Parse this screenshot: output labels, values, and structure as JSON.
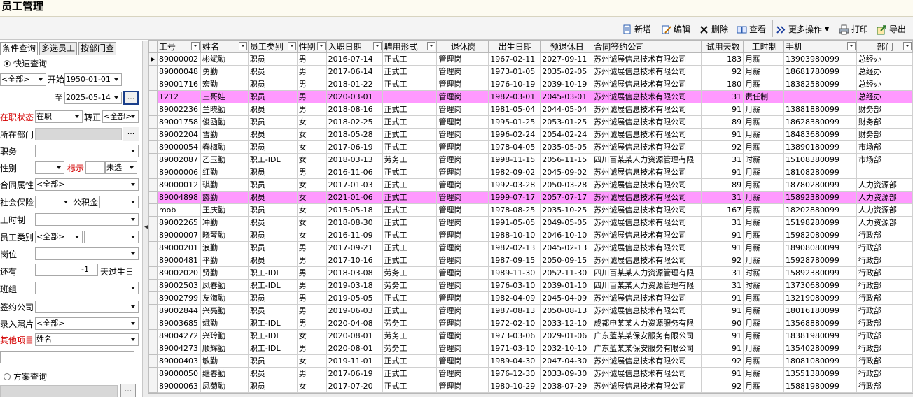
{
  "window_title": "员工管理",
  "toolbar": [
    {
      "label": "新增",
      "icon": "new-doc-icon"
    },
    {
      "label": "编辑",
      "icon": "edit-icon"
    },
    {
      "label": "删除",
      "icon": "delete-x-icon"
    },
    {
      "label": "查看",
      "icon": "view-book-icon"
    },
    {
      "label": "更多操作",
      "icon": "double-chevron-icon"
    },
    {
      "label": "打印",
      "icon": "printer-icon"
    },
    {
      "label": "导出",
      "icon": "export-icon"
    }
  ],
  "tabs": [
    "条件查询",
    "多选员工",
    "按部门查"
  ],
  "filters": {
    "quick_query": "快速查询",
    "scope": "<全部>",
    "start_label": "开始",
    "start_date": "1950-01-01",
    "to_label": "至",
    "end_date": "2025-05-14",
    "ellipsis": "...",
    "status_label": "在职状态",
    "status_value": "在职",
    "regular_label": "转正",
    "regular_value": "<全部>",
    "dept_label": "所在部门",
    "post_label": "职务",
    "gender_label": "性别",
    "show_label": "标示",
    "unselected": "未选",
    "contract_label": "合同属性",
    "contract_value": "<全部>",
    "insurance_label": "社会保险",
    "fund_label": "公积金",
    "worktime_label": "工时制",
    "emptype_label": "员工类别",
    "emptype_value": "<全部>",
    "position_label": "岗位",
    "birthday_prefix": "还有",
    "birthday_value": "-1",
    "birthday_suffix": "天过生日",
    "team_label": "班组",
    "company_label": "签约公司",
    "photo_label": "录入照片",
    "photo_value": "<全部>",
    "other_label": "其他项目",
    "other_value": "姓名",
    "plan_query": "方案查询"
  },
  "columns": [
    "工号",
    "姓名",
    "员工类别",
    "性别",
    "入职日期",
    "聘用形式",
    "退休岗",
    "出生日期",
    "预退休日",
    "合同签约公司",
    "试用天数",
    "工时制",
    "手机",
    "部门"
  ],
  "rows": [
    [
      "89000002",
      "彬斌勤",
      "职员",
      "男",
      "2016-07-14",
      "正式工",
      "管理岗",
      "1967-02-11",
      "2027-09-11",
      "苏州诚展信息技术有限公司",
      "183",
      "月薪",
      "13903980099",
      "总经办"
    ],
    [
      "89000048",
      "勇勤",
      "职员",
      "男",
      "2017-06-14",
      "正式工",
      "管理岗",
      "1973-01-05",
      "2035-02-05",
      "苏州诚展信息技术有限公司",
      "92",
      "月薪",
      "18681780099",
      "总经办"
    ],
    [
      "89001716",
      "宏勤",
      "职员",
      "男",
      "2018-01-22",
      "正式工",
      "管理岗",
      "1976-10-19",
      "2039-10-19",
      "苏州诚展信息技术有限公司",
      "180",
      "月薪",
      "18382580099",
      "总经办"
    ],
    [
      "1212",
      "三哥娃",
      "职员",
      "男",
      "2020-03-01",
      "",
      "管理岗",
      "1982-03-01",
      "2045-03-01",
      "苏州诚展信息技术有限公司",
      "31",
      "责任制",
      "",
      "总经办"
    ],
    [
      "89002236",
      "兰晓勤",
      "职员",
      "男",
      "2018-08-16",
      "正式工",
      "管理岗",
      "1981-05-04",
      "2044-05-04",
      "苏州诚展信息技术有限公司",
      "91",
      "月薪",
      "13881880099",
      "财务部"
    ],
    [
      "89001758",
      "俊函勤",
      "职员",
      "女",
      "2018-02-25",
      "正式工",
      "管理岗",
      "1995-01-25",
      "2053-01-25",
      "苏州诚展信息技术有限公司",
      "89",
      "月薪",
      "18628380099",
      "财务部"
    ],
    [
      "89002204",
      "雪勤",
      "职员",
      "女",
      "2018-05-28",
      "正式工",
      "管理岗",
      "1996-02-24",
      "2054-02-24",
      "苏州诚展信息技术有限公司",
      "91",
      "月薪",
      "18483680099",
      "财务部"
    ],
    [
      "89000054",
      "春梅勤",
      "职员",
      "女",
      "2017-06-19",
      "正式工",
      "管理岗",
      "1978-04-05",
      "2035-05-05",
      "苏州诚展信息技术有限公司",
      "92",
      "月薪",
      "13890180099",
      "市场部"
    ],
    [
      "89002087",
      "乙玉勤",
      "职工-IDL",
      "女",
      "2018-03-13",
      "劳务工",
      "管理岗",
      "1998-11-15",
      "2056-11-15",
      "四川百某某人力资源管理有限",
      "31",
      "时薪",
      "15108380099",
      "市场部"
    ],
    [
      "89000006",
      "红勤",
      "职员",
      "男",
      "2016-11-06",
      "正式工",
      "管理岗",
      "1982-09-02",
      "2045-09-02",
      "苏州诚展信息技术有限公司",
      "91",
      "月薪",
      "18108280099",
      ""
    ],
    [
      "89000012",
      "琪勤",
      "职员",
      "女",
      "2017-01-03",
      "正式工",
      "管理岗",
      "1992-03-28",
      "2050-03-28",
      "苏州诚展信息技术有限公司",
      "89",
      "月薪",
      "18780280099",
      "人力资源部"
    ],
    [
      "89004898",
      "露勤",
      "职员",
      "女",
      "2021-01-06",
      "正式工",
      "管理岗",
      "1999-07-17",
      "2057-07-17",
      "苏州诚展信息技术有限公司",
      "31",
      "月薪",
      "15892380099",
      "人力资源部"
    ],
    [
      "mob",
      "王庆勤",
      "职员",
      "女",
      "2015-05-18",
      "正式工",
      "管理岗",
      "1978-08-25",
      "2035-10-25",
      "苏州诚展信息技术有限公司",
      "167",
      "月薪",
      "18202880099",
      "人力资源部"
    ],
    [
      "89002265",
      "冲勤",
      "职员",
      "女",
      "2018-08-30",
      "正式工",
      "管理岗",
      "1991-05-05",
      "2049-05-05",
      "苏州诚展信息技术有限公司",
      "31",
      "月薪",
      "15198280099",
      "人力资源部"
    ],
    [
      "89000007",
      "晓琴勤",
      "职员",
      "女",
      "2016-11-09",
      "正式工",
      "管理岗",
      "1988-10-10",
      "2046-10-10",
      "苏州诚展信息技术有限公司",
      "91",
      "月薪",
      "15982080099",
      "行政部"
    ],
    [
      "89000201",
      "浪勤",
      "职员",
      "男",
      "2017-09-21",
      "正式工",
      "管理岗",
      "1982-02-13",
      "2045-02-13",
      "苏州诚展信息技术有限公司",
      "91",
      "月薪",
      "18908080099",
      "行政部"
    ],
    [
      "89000481",
      "平勤",
      "职员",
      "男",
      "2017-10-16",
      "正式工",
      "管理岗",
      "1987-09-15",
      "2050-09-15",
      "苏州诚展信息技术有限公司",
      "92",
      "月薪",
      "15928780099",
      "行政部"
    ],
    [
      "89002020",
      "贤勤",
      "职工-IDL",
      "男",
      "2018-03-08",
      "劳务工",
      "管理岗",
      "1989-11-30",
      "2052-11-30",
      "四川百某某人力资源管理有限",
      "31",
      "时薪",
      "15892380099",
      "行政部"
    ],
    [
      "89002503",
      "凤春勤",
      "职工-IDL",
      "男",
      "2019-03-18",
      "劳务工",
      "管理岗",
      "1976-03-10",
      "2039-01-10",
      "四川百某某人力资源管理有限",
      "31",
      "时薪",
      "13730680099",
      "行政部"
    ],
    [
      "89002799",
      "友海勤",
      "职员",
      "男",
      "2019-05-05",
      "正式工",
      "管理岗",
      "1982-04-09",
      "2045-04-09",
      "苏州诚展信息技术有限公司",
      "91",
      "月薪",
      "13219080099",
      "行政部"
    ],
    [
      "89002844",
      "兴亮勤",
      "职员",
      "男",
      "2019-06-03",
      "正式工",
      "管理岗",
      "1987-08-13",
      "2050-08-13",
      "苏州诚展信息技术有限公司",
      "91",
      "月薪",
      "18016180099",
      "行政部"
    ],
    [
      "89003685",
      "斌勤",
      "职工-IDL",
      "男",
      "2020-04-08",
      "劳务工",
      "管理岗",
      "1972-02-10",
      "2033-12-10",
      "成都申某某人力资源服务有限",
      "90",
      "月薪",
      "13568880099",
      "行政部"
    ],
    [
      "89004272",
      "兴玲勤",
      "职工-IDL",
      "女",
      "2020-08-01",
      "劳务工",
      "管理岗",
      "1973-03-06",
      "2029-01-06",
      "广东蓝某某保安服务有限公司",
      "91",
      "月薪",
      "18381980099",
      "行政部"
    ],
    [
      "89004273",
      "顺辉勤",
      "职工-IDL",
      "男",
      "2020-08-01",
      "劳务工",
      "管理岗",
      "1971-03-10",
      "2032-10-10",
      "广东蓝某某保安服务有限公司",
      "91",
      "月薪",
      "13540280099",
      "行政部"
    ],
    [
      "89000403",
      "敏勤",
      "职员",
      "女",
      "2019-11-01",
      "正式工",
      "管理岗",
      "1989-04-30",
      "2047-04-30",
      "苏州诚展信息技术有限公司",
      "92",
      "月薪",
      "18081080099",
      "行政部"
    ],
    [
      "89000050",
      "继春勤",
      "职员",
      "男",
      "2017-06-19",
      "正式工",
      "管理岗",
      "1976-12-30",
      "2033-09-30",
      "苏州诚展信息技术有限公司",
      "91",
      "月薪",
      "13551380099",
      "行政部"
    ],
    [
      "89000063",
      "凤菊勤",
      "职员",
      "女",
      "2017-07-20",
      "正式工",
      "管理岗",
      "1980-10-29",
      "2038-07-29",
      "苏州诚展信息技术有限公司",
      "92",
      "月薪",
      "15881980099",
      "行政部"
    ]
  ],
  "highlighted_rows": [
    3,
    11
  ],
  "highlight_color": "#ff99ff"
}
